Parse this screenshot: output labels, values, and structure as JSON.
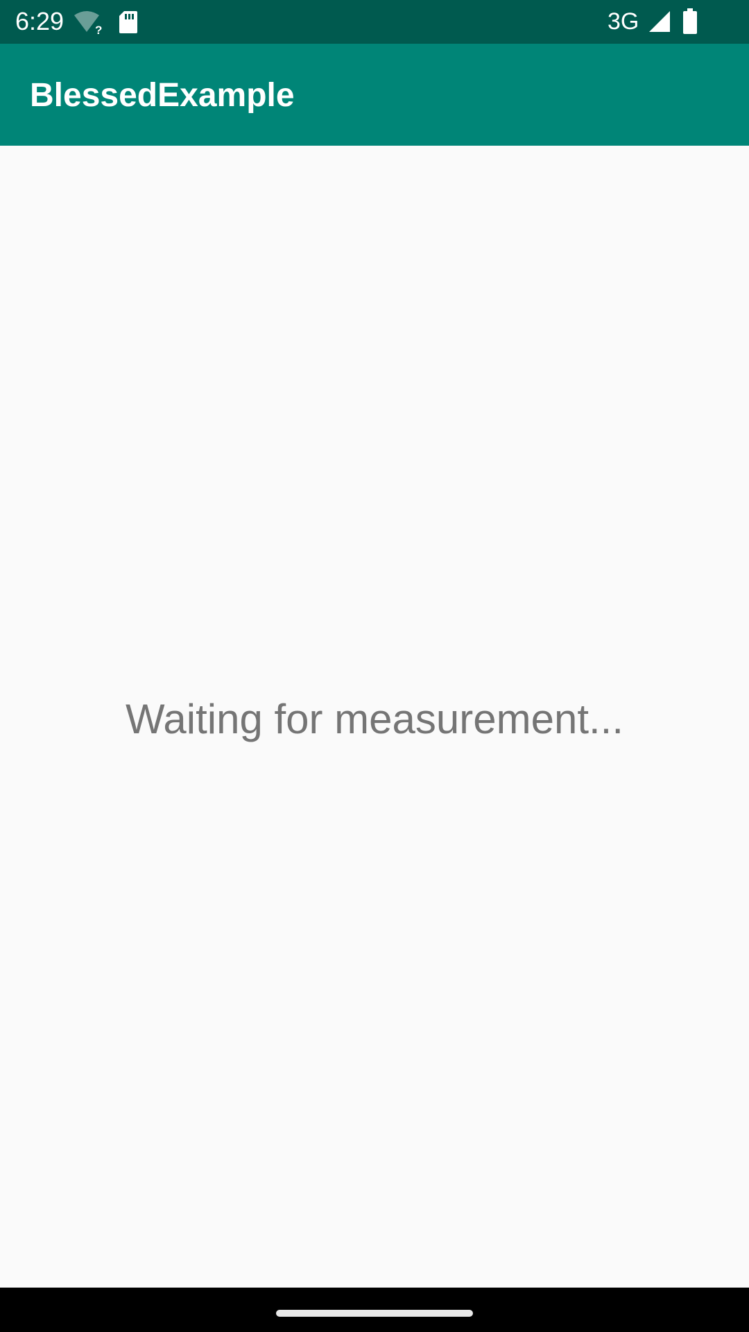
{
  "status_bar": {
    "time": "6:29",
    "network": "3G",
    "icons": [
      "wifi-unknown-icon",
      "sd-card-icon",
      "cell-signal-icon",
      "battery-icon"
    ],
    "background_color": "#005a4f"
  },
  "app_bar": {
    "title": "BlessedExample",
    "background_color": "#008577"
  },
  "main": {
    "status_text": "Waiting for measurement..."
  },
  "nav_bar": {
    "icons": [
      "home-handle"
    ]
  }
}
